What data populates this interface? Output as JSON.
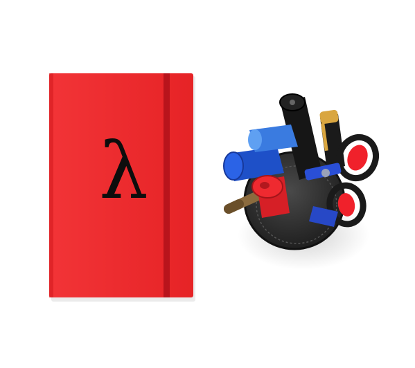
{
  "notebook": {
    "cover_symbol": "λ",
    "cover_color": "#ec2a2c",
    "band_color": "#b8141c"
  },
  "pen_cup": {
    "cup_color": "#2f2f2f",
    "items": [
      "blue-marker-icon",
      "red-marker-icon",
      "black-marker-icon",
      "pen-icon",
      "scissors-icon",
      "pencil-icon"
    ]
  }
}
